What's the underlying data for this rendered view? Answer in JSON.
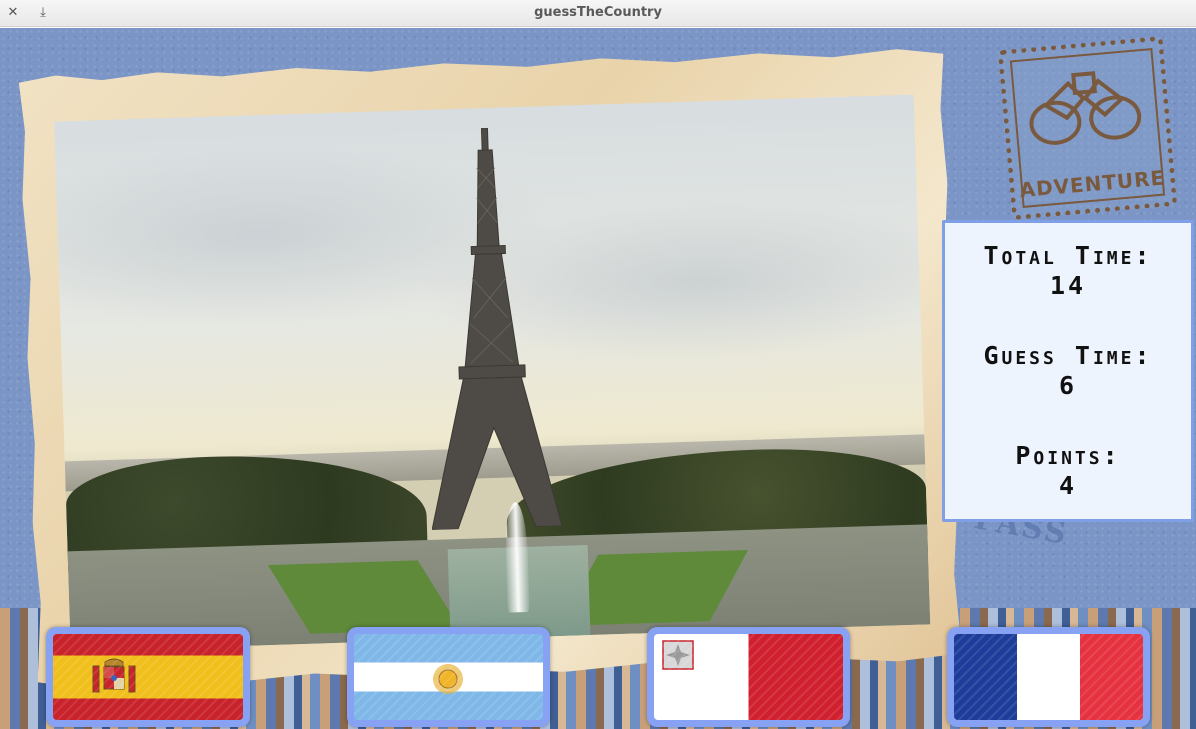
{
  "window": {
    "title": "guessTheCountry",
    "close_icon": "✕",
    "download_icon": "⤓"
  },
  "stamps": {
    "adventure": "ADVENTURE",
    "boarding_pass": "PASS"
  },
  "stats": {
    "total_time_label": "Total Time:",
    "total_time_value": "14",
    "guess_time_label": "Guess Time:",
    "guess_time_value": "6",
    "points_label": "Points:",
    "points_value": "4"
  },
  "flags": [
    {
      "country": "Spain",
      "icon": "spain-flag-icon"
    },
    {
      "country": "Argentina",
      "icon": "argentina-flag-icon"
    },
    {
      "country": "Malta",
      "icon": "malta-flag-icon"
    },
    {
      "country": "France",
      "icon": "france-flag-icon"
    }
  ],
  "colors": {
    "panel_border": "#7f9fe6",
    "flag_button": "#88a2f3",
    "background": "#7b95c6"
  }
}
